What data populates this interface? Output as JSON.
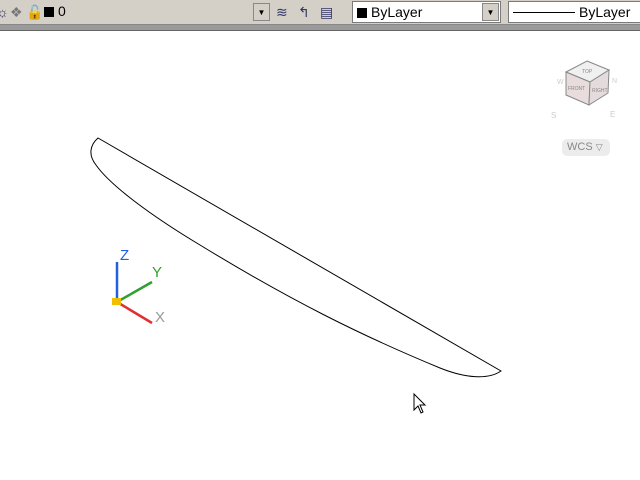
{
  "toolbar": {
    "layer_value": "0",
    "color_value": "ByLayer",
    "linetype_value": "ByLayer",
    "icons": [
      "lightbulb-icon",
      "freeze-icon",
      "unlock-icon",
      "layer-manager-icon",
      "layer-previous-icon",
      "layer-states-icon"
    ]
  },
  "viewcube": {
    "top": "TOP",
    "front": "FRONT",
    "right": "RIGHT",
    "compass": [
      "W",
      "N",
      "S",
      "E"
    ],
    "wcs_label": "WCS"
  },
  "ucs": {
    "x": "X",
    "y": "Y",
    "z": "Z"
  },
  "colors": {
    "ucs_x": "#e03030",
    "ucs_y": "#30a030",
    "ucs_z": "#2060e0"
  }
}
